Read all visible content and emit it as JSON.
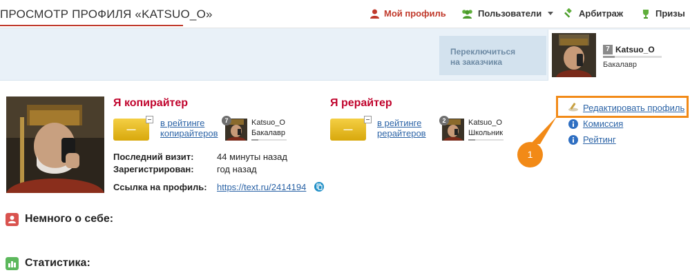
{
  "header": {
    "page_title": "ПРОСМОТР ПРОФИЛЯ «KATSUO_O»",
    "nav": {
      "my_profile": "Мой профиль",
      "users": "Пользователи",
      "arbitration": "Арбитраж",
      "prizes": "Призы"
    }
  },
  "switch_button": {
    "line1": "Переключиться",
    "line2": "на заказчика"
  },
  "user_card": {
    "level": "7",
    "name": "Katsuo_O",
    "rank": "Бакалавр"
  },
  "copywriter": {
    "title": "Я копирайтер",
    "badge": "—",
    "rating_link_line1": "в рейтинге",
    "rating_link_line2": "копирайтеров",
    "level": "7",
    "name": "Katsuo_O",
    "rank": "Бакалавр"
  },
  "rewriter": {
    "title": "Я рерайтер",
    "badge": "—",
    "rating_link_line1": "в рейтинге",
    "rating_link_line2": "рерайтеров",
    "level": "2",
    "name": "Katsuo_O",
    "rank": "Школьник"
  },
  "info": {
    "last_visit_label": "Последний визит:",
    "last_visit_value": "44 минуты назад",
    "registered_label": "Зарегистрирован:",
    "registered_value": "год назад",
    "profile_link_label": "Ссылка на профиль:",
    "profile_link_value": "https://text.ru/2414194"
  },
  "side_links": {
    "edit_profile": "Редактировать профиль",
    "commission": "Комиссия",
    "rating": "Рейтинг"
  },
  "callout": {
    "number": "1",
    "color": "#f28a17"
  },
  "sections": {
    "about": "Немного о себе:",
    "stats": "Статистика:"
  },
  "colors": {
    "accent_red": "#c0032c",
    "link_blue": "#2b63a6",
    "strip_blue": "#e9f1f8",
    "badge_gold": "#e0b21e"
  }
}
